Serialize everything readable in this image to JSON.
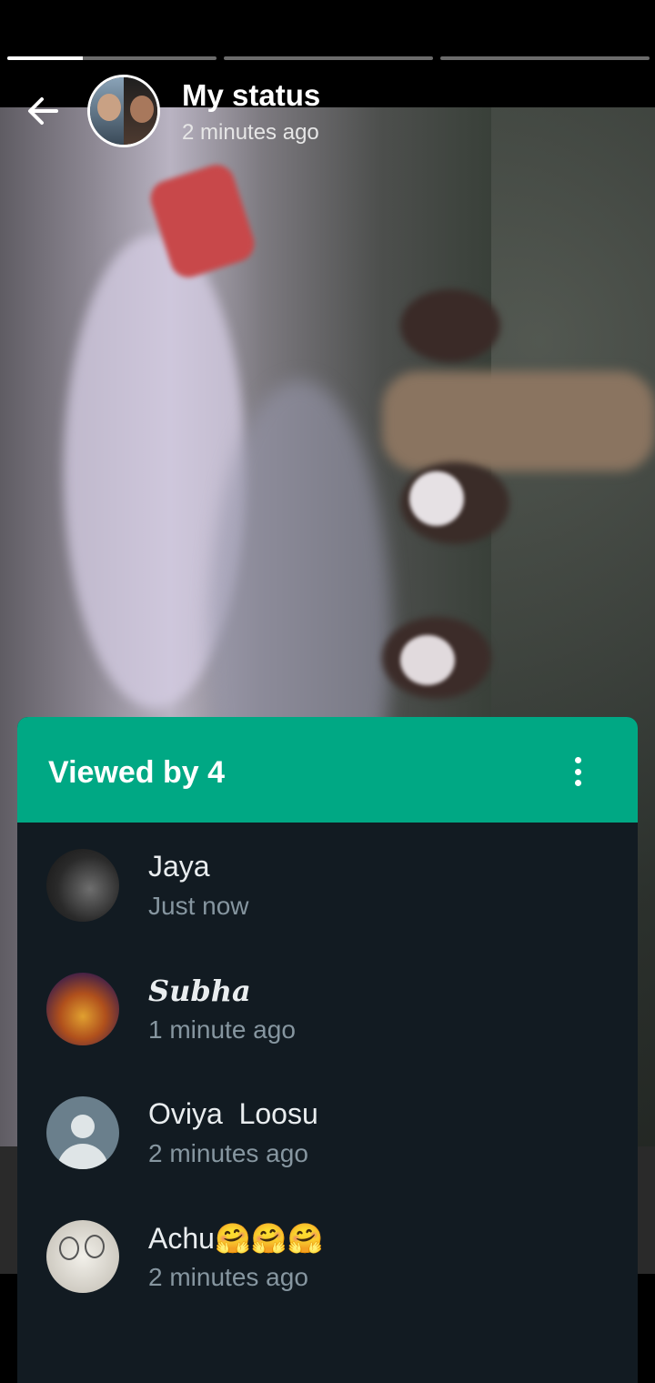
{
  "status": {
    "title": "My status",
    "time": "2 minutes ago",
    "progress": [
      0.36,
      0,
      0
    ]
  },
  "viewers": {
    "header": "Viewed by 4",
    "list": [
      {
        "name": "Jaya",
        "time": "Just now"
      },
      {
        "name": "Subha",
        "time": "1 minute ago"
      },
      {
        "name": "Oviya  Loosu",
        "time": "2 minutes ago"
      },
      {
        "name": "Achu🤗🤗🤗",
        "time": "2 minutes ago"
      }
    ]
  },
  "colors": {
    "accent": "#00a884",
    "sheet_bg": "#121b22",
    "secondary_text": "#8696a0"
  },
  "icons": {
    "back": "arrow-left-icon",
    "more": "more-vertical-icon",
    "default_avatar": "person-icon"
  }
}
